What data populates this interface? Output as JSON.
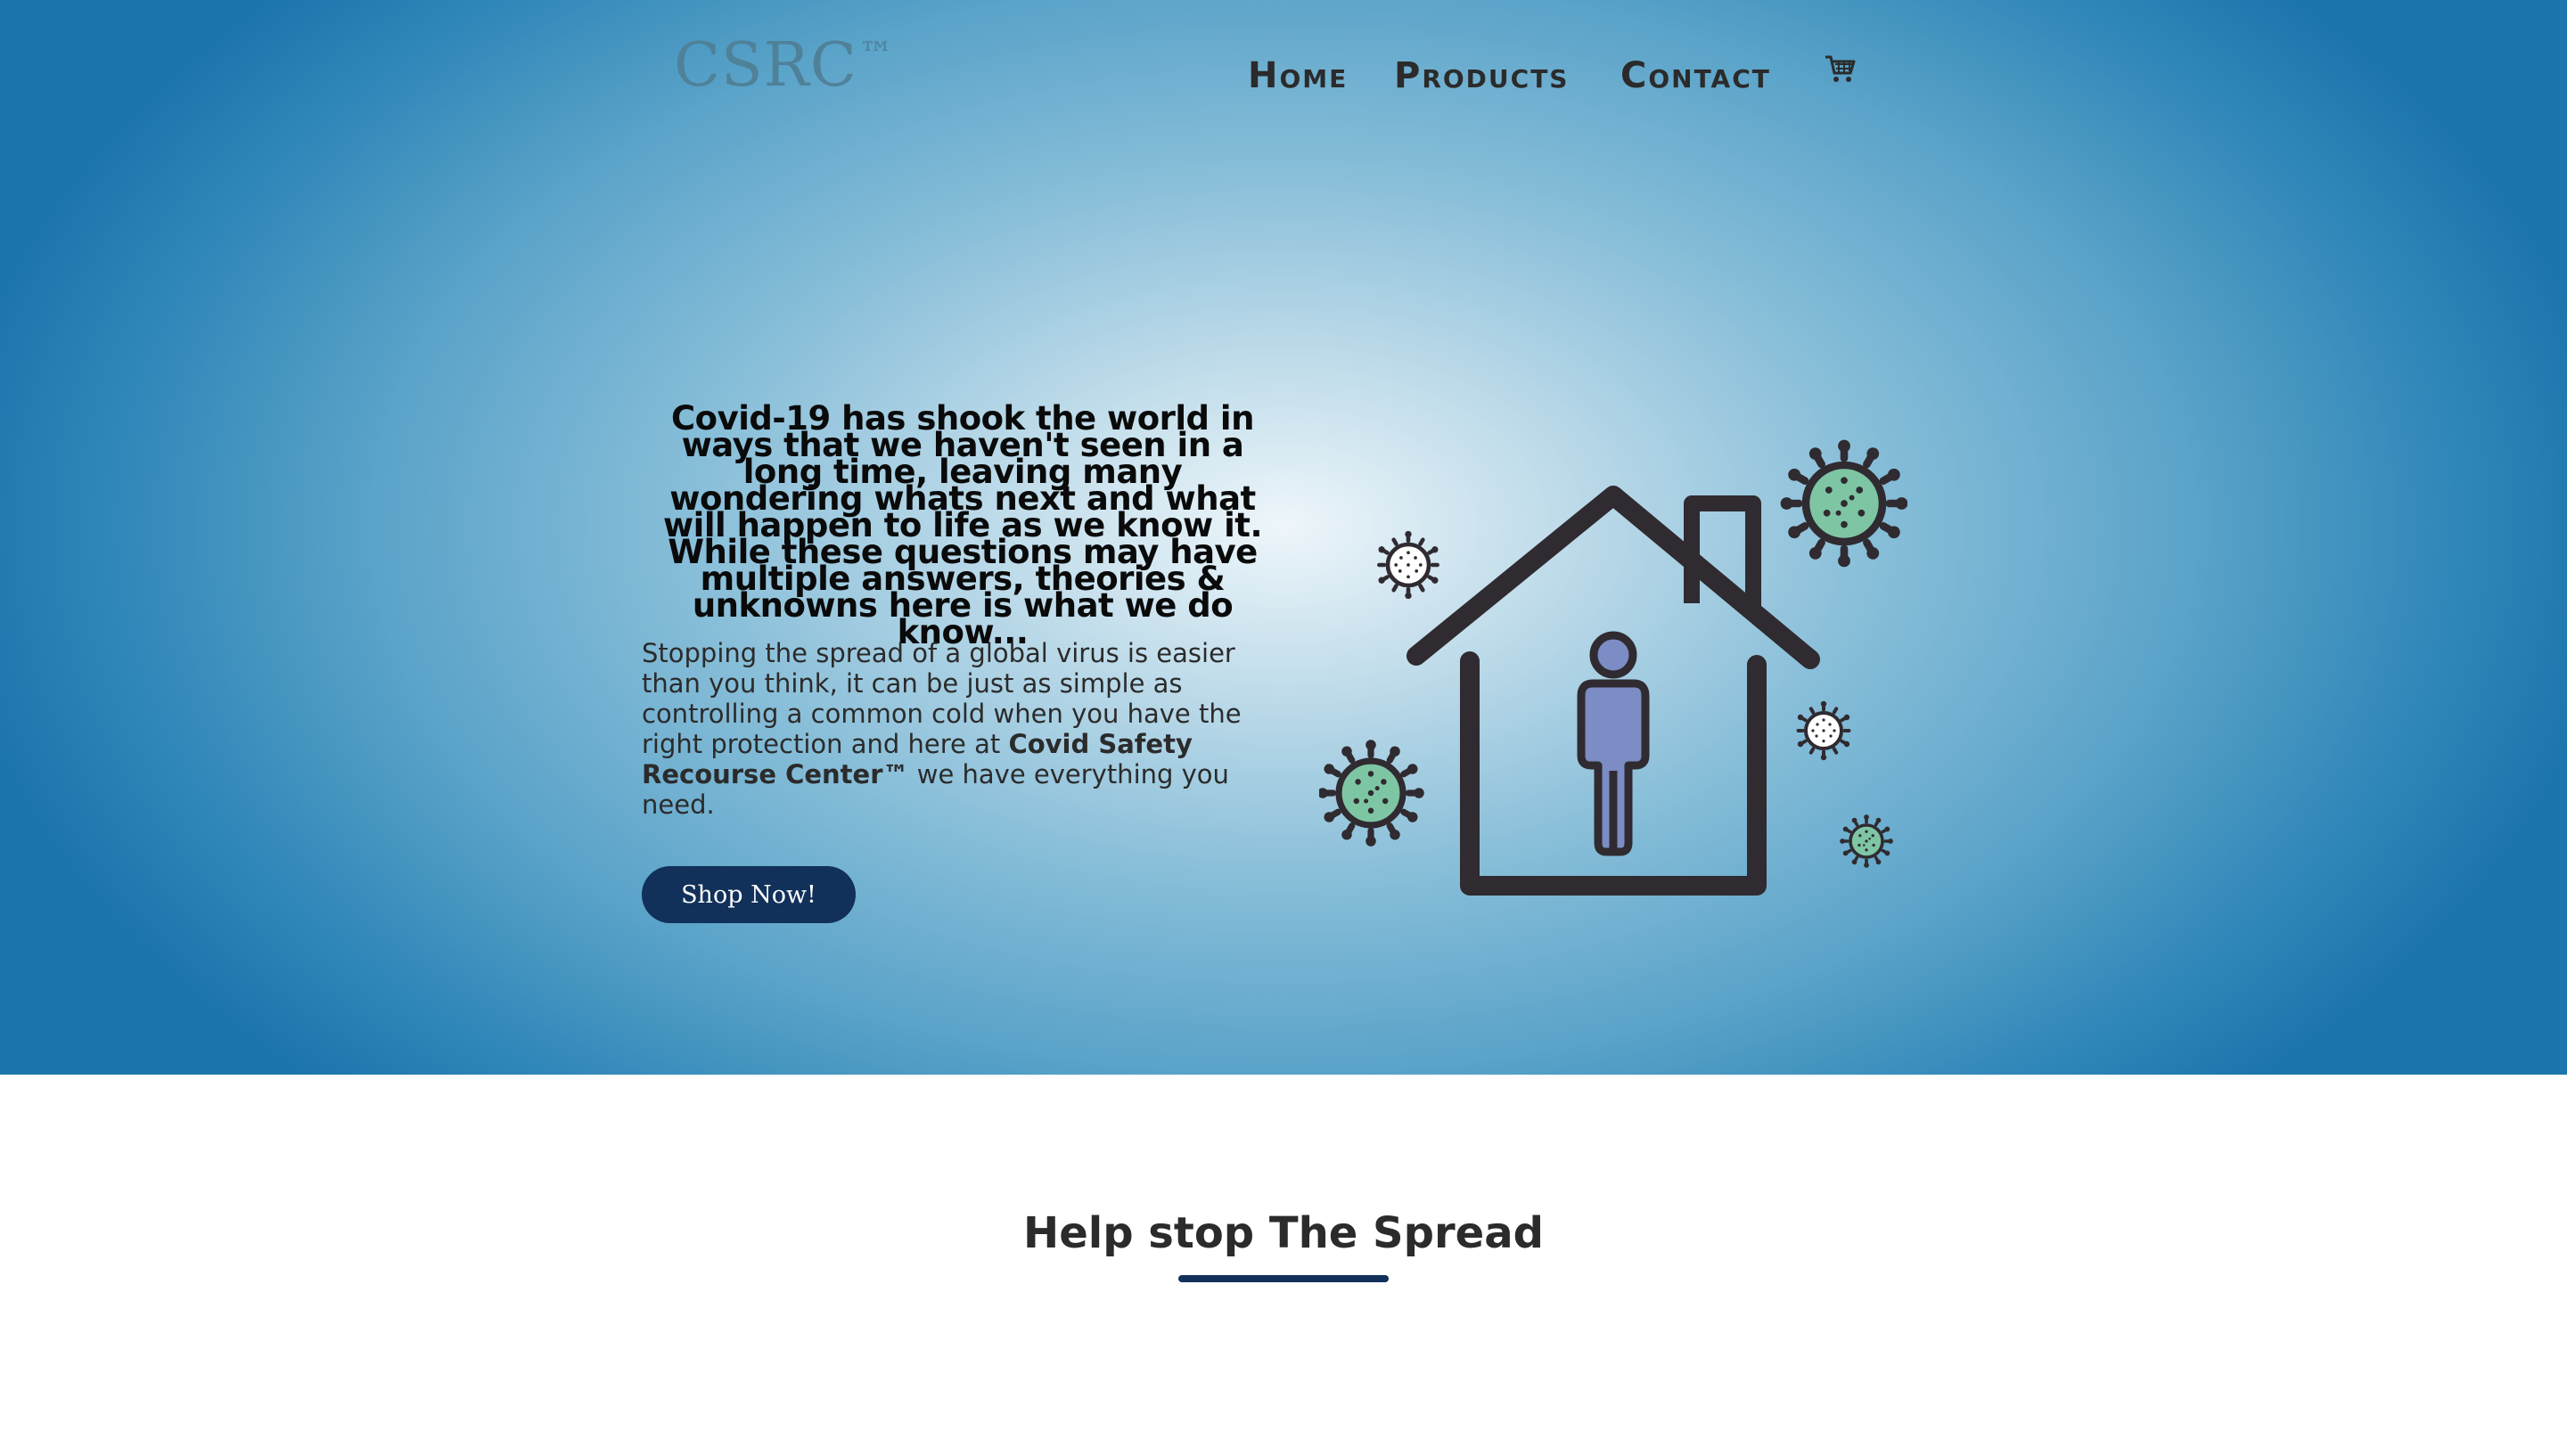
{
  "header": {
    "logo": {
      "text": "CSRC",
      "mark": "™"
    },
    "nav": [
      {
        "label": "Home"
      },
      {
        "label": "Products"
      },
      {
        "label": "Contact"
      }
    ],
    "cart_icon": "shopping-cart-icon"
  },
  "hero": {
    "headline": "Covid-19 has shook the world in ways that we haven't seen in a long time, leaving many wondering whats next and what will happen to life as we know it. While these questions may have multiple answers, theories & unknowns here is what we do know...",
    "body": {
      "text_before": "Stopping the spread of a global virus is easier than you think, it can be just as simple as controlling a common cold when you have the right protection and here at ",
      "brand": "Covid Safety Recourse Center™",
      "text_after": " we have everything you need."
    },
    "cta_label": "Shop Now!",
    "illustration": {
      "icons": [
        "house-icon",
        "person-icon",
        "virus-icon"
      ]
    }
  },
  "section": {
    "title": "Help stop The Spread"
  },
  "colors": {
    "accent": "#11305a",
    "virus_fill": "#7ec5a4",
    "person_fill": "#7c8cc4",
    "outline": "#2f2b30"
  }
}
